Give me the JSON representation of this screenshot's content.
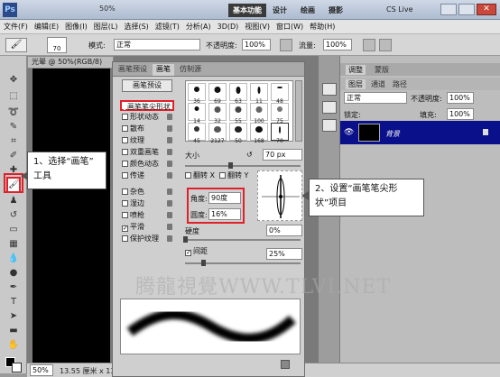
{
  "titlebar": {
    "zoom": "50%",
    "workspace": "基本功能",
    "design": "设计",
    "paint": "绘画",
    "photo": "摄影",
    "cslive": "CS Live"
  },
  "menu": [
    "文件(F)",
    "编辑(E)",
    "图像(I)",
    "图层(L)",
    "选择(S)",
    "滤镜(T)",
    "分析(A)",
    "3D(D)",
    "视图(V)",
    "窗口(W)",
    "帮助(H)"
  ],
  "options": {
    "brush_size": "70",
    "mode_label": "模式:",
    "mode_value": "正常",
    "opacity_label": "不透明度:",
    "opacity_value": "100%",
    "flow_label": "流量:",
    "flow_value": "100%"
  },
  "document": {
    "tab": "光晕 @ 50%(RGB/8)",
    "zoom": "50%",
    "status": "13.55 厘米 x 13.55 厘米 (150 ..."
  },
  "brush_panel": {
    "tabs": [
      "画笔预设",
      "画笔",
      "仿制源"
    ],
    "preset_button": "画笔预设",
    "options": [
      "画笔笔尖形状",
      "形状动态",
      "散布",
      "纹理",
      "双重画笔",
      "颜色动态",
      "传递",
      "杂色",
      "湿边",
      "喷枪",
      "平滑",
      "保护纹理"
    ],
    "checked": [
      false,
      false,
      false,
      false,
      false,
      false,
      false,
      false,
      false,
      false,
      true,
      false
    ],
    "swatches": [
      "36",
      "69",
      "63",
      "11",
      "48",
      "14",
      "32",
      "55",
      "100",
      "75",
      "45",
      "2127",
      "50",
      "168",
      "70",
      "70"
    ],
    "size_label": "大小",
    "size_value": "70 px",
    "flipx": "翻转 X",
    "flipy": "翻转 Y",
    "angle_label": "角度:",
    "angle_value": "90度",
    "roundness_label": "圆度:",
    "roundness_value": "16%",
    "hardness_label": "硬度",
    "hardness_value": "0%",
    "spacing_label": "间距",
    "spacing_value": "25%"
  },
  "layers": {
    "tabs": [
      "调整",
      "蒙版"
    ],
    "subtabs": [
      "图层",
      "通道",
      "路径"
    ],
    "mode": "正常",
    "opacity_label": "不透明度:",
    "opacity_value": "100%",
    "lock_label": "锁定:",
    "fill_label": "填充:",
    "fill_value": "100%",
    "layer_name": "背景"
  },
  "callouts": {
    "c1_line1": "1、选择“画笔”",
    "c1_line2": "工具",
    "c2_line1": "2、设置“画笔笔尖形",
    "c2_line2": "状”项目"
  },
  "watermark": "腾龍視覺WWW.TLVI.NET",
  "colors": {
    "highlight": "#e0202a",
    "layer_blue": "#0a0f8a"
  }
}
